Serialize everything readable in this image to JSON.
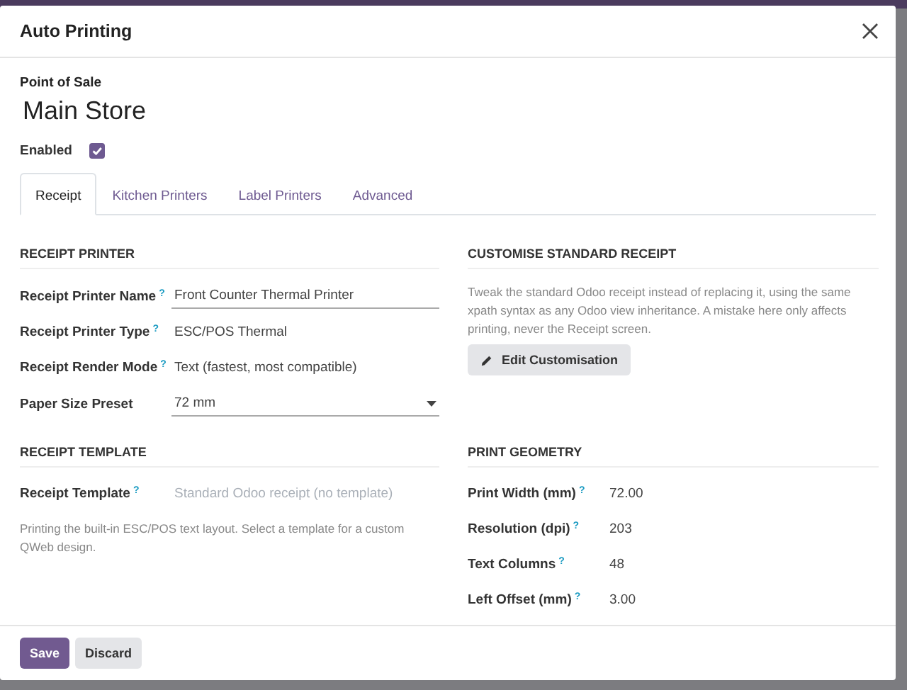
{
  "dialog": {
    "title": "Auto Printing",
    "point_of_sale": {
      "label": "Point of Sale",
      "value": "Main Store"
    },
    "enabled": {
      "label": "Enabled",
      "checked": true
    },
    "tabs": [
      {
        "label": "Receipt",
        "selected": true
      },
      {
        "label": "Kitchen Printers",
        "selected": false
      },
      {
        "label": "Label Printers",
        "selected": false
      },
      {
        "label": "Advanced",
        "selected": false
      }
    ],
    "sections": [
      {
        "title": "RECEIPT PRINTER",
        "fields": [
          {
            "label": "Receipt Printer Name",
            "help": "?",
            "kind": "input",
            "value": "Front Counter Thermal Printer"
          },
          {
            "label": "Receipt Printer Type",
            "help": "?",
            "kind": "text",
            "value": "ESC/POS Thermal"
          },
          {
            "label": "Receipt Render Mode",
            "help": "?",
            "kind": "text",
            "value": "Text (fastest, most compatible)"
          },
          {
            "label": "Paper Size Preset",
            "kind": "select",
            "value": "72 mm"
          }
        ]
      },
      {
        "title": "CUSTOMISE STANDARD RECEIPT",
        "note": "Tweak the standard Odoo receipt instead of replacing it, using the same xpath syntax as any Odoo view inheritance. A mistake here only affects printing, never the Receipt screen.",
        "button": "Edit Customisation"
      },
      {
        "title": "RECEIPT TEMPLATE",
        "fields": [
          {
            "label": "Receipt Template",
            "help": "?",
            "kind": "placeholder",
            "placeholder": "Standard Odoo receipt (no template)"
          }
        ],
        "note": "Printing the built-in ESC/POS text layout. Select a template for a custom QWeb design."
      },
      {
        "title": "PRINT GEOMETRY",
        "fields": [
          {
            "label": "Print Width (mm)",
            "help": "?",
            "kind": "text",
            "value": "72.00"
          },
          {
            "label": "Resolution (dpi)",
            "help": "?",
            "kind": "text",
            "value": "203"
          },
          {
            "label": "Text Columns",
            "help": "?",
            "kind": "text",
            "value": "48"
          },
          {
            "label": "Left Offset (mm)",
            "help": "?",
            "kind": "text",
            "value": "3.00"
          }
        ]
      }
    ],
    "buttons": [
      {
        "label": "Save",
        "kind": "primary"
      },
      {
        "label": "Discard",
        "kind": "secondary"
      }
    ]
  }
}
